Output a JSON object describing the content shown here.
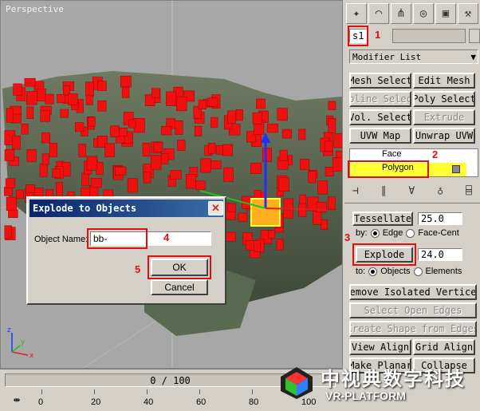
{
  "viewport": {
    "label": "Perspective"
  },
  "panel": {
    "tabs": [
      "create-icon",
      "modify-icon",
      "hierarchy-icon",
      "motion-icon",
      "display-icon",
      "utilities-icon"
    ],
    "object_name": "s1",
    "modifier_list": "Modifier List",
    "modifier_buttons": [
      {
        "label": "Mesh Select",
        "disabled": false
      },
      {
        "label": "Edit Mesh",
        "disabled": false
      },
      {
        "label": "Spline Select",
        "disabled": true
      },
      {
        "label": "Poly Select",
        "disabled": false
      },
      {
        "label": "Vol. Select",
        "disabled": false
      },
      {
        "label": "Extrude",
        "disabled": true
      },
      {
        "label": "UVW Map",
        "disabled": false
      },
      {
        "label": "Unwrap UVW",
        "disabled": false
      }
    ],
    "stack": {
      "item1": "Face",
      "item2": "Polygon"
    },
    "tessellate": {
      "label": "Tessellate",
      "value": "25.0"
    },
    "by": {
      "label": "by:",
      "opt1": "Edge",
      "opt2": "Face-Cent"
    },
    "explode": {
      "button": "Explode",
      "value": "24.0"
    },
    "to": {
      "label": "to:",
      "opt1": "Objects",
      "opt2": "Elements"
    },
    "buttons": [
      {
        "label": "Remove Isolated Vertices",
        "disabled": false
      },
      {
        "label": "Select Open Edges",
        "disabled": true
      },
      {
        "label": "Create Shape from Edges",
        "disabled": true
      },
      {
        "label": "View Align",
        "disabled": false
      },
      {
        "label": "Grid Align",
        "disabled": false
      },
      {
        "label": "Make Planar",
        "disabled": false
      },
      {
        "label": "Collapse",
        "disabled": false
      }
    ]
  },
  "dialog": {
    "title": "Explode to Objects",
    "object_name_label": "Object Name:",
    "object_name_value": "bb-",
    "ok": "OK",
    "cancel": "Cancel"
  },
  "annotations": [
    "1",
    "2",
    "3",
    "4",
    "5"
  ],
  "timeline": {
    "slider": "0 / 100",
    "ticks": [
      "0",
      "20",
      "40",
      "60",
      "80",
      "100"
    ]
  },
  "watermark": {
    "main": "中视典数字科技",
    "sub": "VR-PLATFORM"
  },
  "colors": {
    "face": "#ff1010",
    "highlight": "#ffff33",
    "title": "#0a246a",
    "annotation": "#e01010"
  }
}
